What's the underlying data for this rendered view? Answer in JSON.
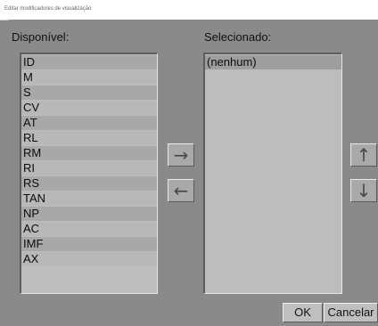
{
  "window": {
    "title": "Editar modificadores de visualização"
  },
  "available": {
    "heading": "Disponível:",
    "items": [
      "ID",
      "M",
      "S",
      "CV",
      "AT",
      "RL",
      "RM",
      "RI",
      "RS",
      "TAN",
      "NP",
      "AC",
      "IMF",
      "AX"
    ]
  },
  "selected": {
    "heading": "Selecionado:",
    "items": [
      "(nenhum)"
    ]
  },
  "buttons": {
    "add_icon": "→",
    "remove_icon": "←",
    "up_icon": "↑",
    "down_icon": "↓",
    "ok": "OK",
    "cancel": "Cancelar"
  }
}
